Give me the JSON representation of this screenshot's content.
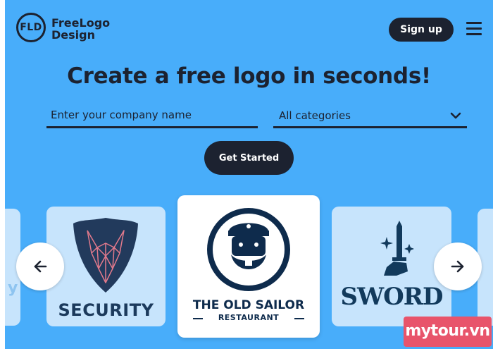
{
  "header": {
    "logo_mark": "FLD",
    "logo_line1": "FreeLogo",
    "logo_line2": "Design",
    "signup_label": "Sign up",
    "menu_icon": "hamburger-icon"
  },
  "hero": {
    "headline": "Create a free logo in seconds!",
    "company_placeholder": "Enter your company name",
    "category_value": "All categories",
    "get_started_label": "Get Started"
  },
  "carousel": {
    "cards": [
      {
        "name": "SECURITY",
        "icon": "wolf-shield-icon"
      },
      {
        "name": "THE OLD SAILOR",
        "subtitle": "RESTAURANT",
        "icon": "sailor-badge-icon"
      },
      {
        "name": "SWORD",
        "icon": "sword-hand-icon"
      }
    ],
    "left_peek_char": "y",
    "prev_icon": "arrow-left-icon",
    "next_icon": "arrow-right-icon"
  },
  "watermark": "mytour.vn",
  "colors": {
    "background": "#48adfa",
    "dark": "#1c2230",
    "card": "#c7e4fc",
    "navy": "#0e2b4c",
    "watermark": "#e8546b"
  }
}
